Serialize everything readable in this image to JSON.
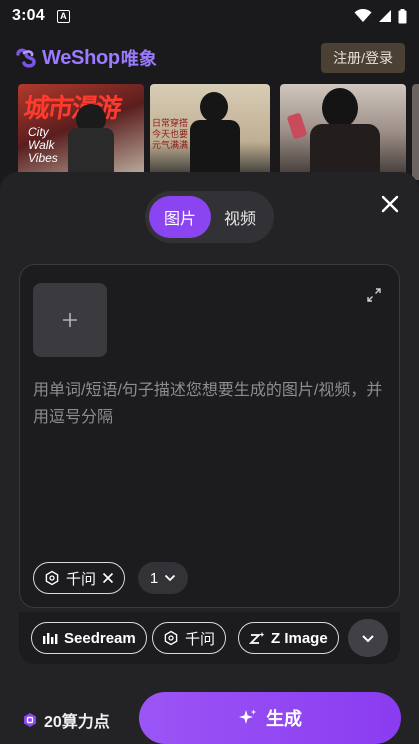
{
  "status_bar": {
    "time": "3:04",
    "notification_glyph": "A"
  },
  "header": {
    "brand": "WeShop",
    "brand_cn": "唯象",
    "login_label": "注册/登录"
  },
  "gallery": {
    "thumb1_text": "城市漫游",
    "thumb1_subtext": "City Walk Vibes",
    "thumb2_text": "日常穿搭 今天也要 元气满满"
  },
  "sheet": {
    "tabs": [
      {
        "label": "图片",
        "active": true
      },
      {
        "label": "视频",
        "active": false
      }
    ],
    "prompt_placeholder": "用单词/短语/句子描述您想要生成的图片/视频，并用逗号分隔",
    "selected_model_chip": "千问",
    "count_value": "1",
    "models": [
      {
        "label": "Seedream",
        "icon": "bars-icon"
      },
      {
        "label": "千问",
        "icon": "qwen-icon"
      },
      {
        "label": "Z Image",
        "icon": "z-sparkle-icon"
      }
    ],
    "credits_label": "20算力点",
    "generate_label": "生成"
  },
  "colors": {
    "accent": "#8a44f0",
    "brand": "#9a7bff",
    "sheet_bg": "#232326",
    "card_bg": "#1c1c1f"
  }
}
